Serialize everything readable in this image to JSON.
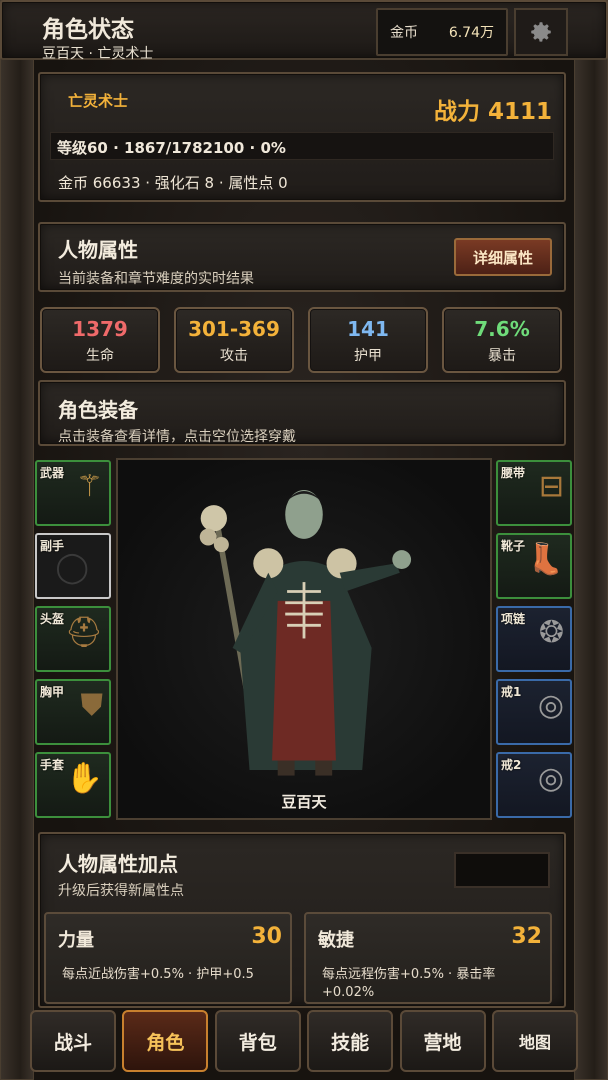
{
  "header": {
    "title": "角色状态",
    "subtitle": "豆百天 · 亡灵术士",
    "coin_label": "金币",
    "coin_value": "6.74万"
  },
  "class_panel": {
    "class_name": "亡灵术士",
    "power": "战力 4111",
    "level_line": "等级60 · 1867/1782100 · 0%",
    "resources": "金币 66633 · 强化石 8 · 属性点 0"
  },
  "attributes": {
    "title": "人物属性",
    "subtitle": "当前装备和章节难度的实时结果",
    "detail_button": "详细属性"
  },
  "stats": [
    {
      "value": "1379",
      "label": "生命",
      "color": "#ef6a6a"
    },
    {
      "value": "301-369",
      "label": "攻击",
      "color": "#f3b23a"
    },
    {
      "value": "141",
      "label": "护甲",
      "color": "#7fb8f0"
    },
    {
      "value": "7.6%",
      "label": "暴击",
      "color": "#6fdc7a"
    }
  ],
  "equipment": {
    "title": "角色装备",
    "subtitle": "点击装备查看详情，点击空位选择穿戴",
    "left_slots": [
      {
        "label": "武器",
        "icon": "staff-icon",
        "glyph": "⚚"
      },
      {
        "label": "副手",
        "icon": "empty-slot-icon",
        "glyph": "◯"
      },
      {
        "label": "头盔",
        "icon": "hood-icon",
        "glyph": "⛑"
      },
      {
        "label": "胸甲",
        "icon": "robe-icon",
        "glyph": "⛊"
      },
      {
        "label": "手套",
        "icon": "gloves-icon",
        "glyph": "✋"
      }
    ],
    "right_slots": [
      {
        "label": "腰带",
        "icon": "belt-icon",
        "glyph": "⊟"
      },
      {
        "label": "靴子",
        "icon": "boots-icon",
        "glyph": "👢"
      },
      {
        "label": "项链",
        "icon": "necklace-icon",
        "glyph": "❂"
      },
      {
        "label": "戒1",
        "icon": "ring-icon",
        "glyph": "◎"
      },
      {
        "label": "戒2",
        "icon": "ring-icon",
        "glyph": "◎"
      }
    ],
    "character_name": "豆百天"
  },
  "points": {
    "title": "人物属性加点",
    "subtitle": "升级后获得新属性点",
    "cards": [
      {
        "name": "力量",
        "value": "30",
        "desc": "每点近战伤害+0.5% · 护甲+0.5"
      },
      {
        "name": "敏捷",
        "value": "32",
        "desc": "每点远程伤害+0.5% · 暴击率+0.02%"
      }
    ]
  },
  "nav": [
    {
      "label": "战斗",
      "active": false
    },
    {
      "label": "角色",
      "active": true
    },
    {
      "label": "背包",
      "active": false
    },
    {
      "label": "技能",
      "active": false
    },
    {
      "label": "营地",
      "active": false
    },
    {
      "label": "地图",
      "active": false
    }
  ]
}
